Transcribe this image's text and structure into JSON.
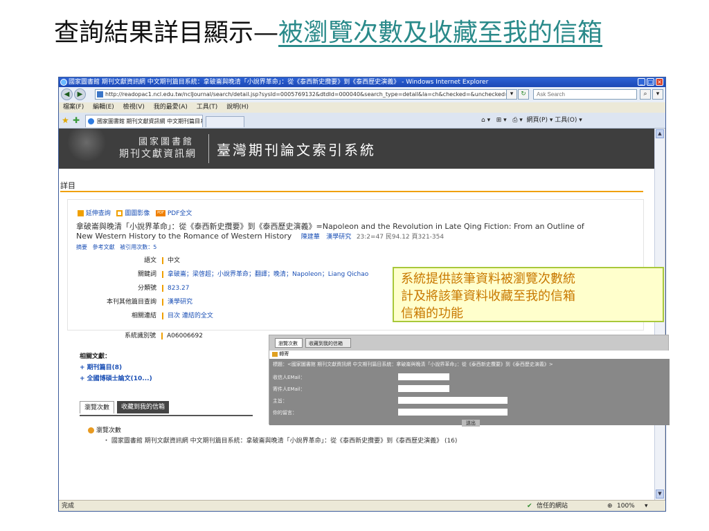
{
  "slide": {
    "title_main": "查詢結果詳目顯示—",
    "title_sub": "被瀏覽次數及收藏至我的信箱"
  },
  "browser": {
    "window_title": "國家圖書館 期刊文獻資訊網 中文期刊篇目系統：拿破崙與晚清「小說界革命」：從《泰西新史攬要》到《泰西歷史演義》 - Windows Internet Explorer",
    "address": "http://readopac1.ncl.edu.tw/nclJournal/search/detail.jsp?sysId=0005769132&dtdId=000040&search_type=detail&la=ch&checked=&unchecked=001000",
    "search_placeholder": "Ask Search",
    "menu": [
      "檔案(F)",
      "編輯(E)",
      "檢視(V)",
      "我的最愛(A)",
      "工具(T)",
      "說明(H)"
    ],
    "tab_label": "國家圖書館 期刊文獻資訊網 中文期刊篇目系...",
    "toolbar_right": "網頁(P) ▾  工具(O) ▾",
    "status_left": "完成",
    "status_trusted": "信任的網站",
    "zoom": "100%"
  },
  "page": {
    "lib_name": "國家圖書館",
    "net_name": "期刊文獻資訊網",
    "system_name": "臺灣期刊論文索引系統",
    "detail_heading": "詳目",
    "actions": [
      "延伸查詢",
      "圖圖影像",
      "PDF全文"
    ],
    "article_title_1": "拿破崙與晚清「小說界革命」：從《泰西新史攬要》到《泰西歷史演義》=Napoleon and the Revolution in Late Qing Fiction: From an Outline of",
    "article_title_2": "New Western History to the Romance of Western History",
    "author": "陳建華",
    "journal": "漢學研究",
    "citation": "23:2=47 民94.12  頁321-354",
    "subnav": [
      "摘要",
      "參考文獻",
      "被引用次數：5"
    ],
    "meta": [
      {
        "label": "語文",
        "value": "中文"
      },
      {
        "label": "關鍵詞",
        "value": "拿破崙；梁啓超；小說界革命；翻譯；晚清；Napoleon；Liang Qichao"
      },
      {
        "label": "分類號",
        "value": "823.27"
      },
      {
        "label": "本刊其他篇目查詢",
        "value": "漢學研究"
      },
      {
        "label": "相關連結",
        "value": "目次 連結的全文"
      },
      {
        "label": "系統識別號",
        "value": "A06006692"
      }
    ],
    "related_heading": "相關文獻：",
    "related_1": "+ 期刊篇目(8)",
    "related_2": "+ 全國博碩士論文(10...)",
    "tab_views": "瀏覽次數",
    "tab_mailbox": "收藏到我的信箱",
    "views_heading": "瀏覽次數",
    "views_item": "・ 國家圖書館 期刊文獻資訊網 中文期刊篇目系統：拿破崙與晚清「小說界革命」：從《泰西新史攬要》到《泰西歷史演義》 (16)"
  },
  "callout": {
    "line1": "系統提供該筆資料被瀏覽次數統",
    "line2": "計及將該筆資料收藏至我的信箱",
    "line3": "信箱的功能"
  },
  "mail_panel": {
    "tab_views": "瀏覽次數",
    "tab_mailbox": "收藏到我的信箱",
    "send_heading": "轉寄",
    "subject_line": "標題：<國家圖書館 期刊文獻資訊網 中文期刊篇目系統：拿破崙與晚清「小說界革命」：從《泰西新史攬要》到《泰西歷史演義》>",
    "recipient_label": "收信人EMail：",
    "sender_label": "寄件人EMail：",
    "subject_label": "主旨：",
    "message_label": "你的留言：",
    "send_button": "送出"
  },
  "colors": {
    "accent_orange": "#f0a000",
    "link_blue": "#1a4fb5",
    "callout_text": "#c87800",
    "title_teal": "#2a8a8a"
  }
}
